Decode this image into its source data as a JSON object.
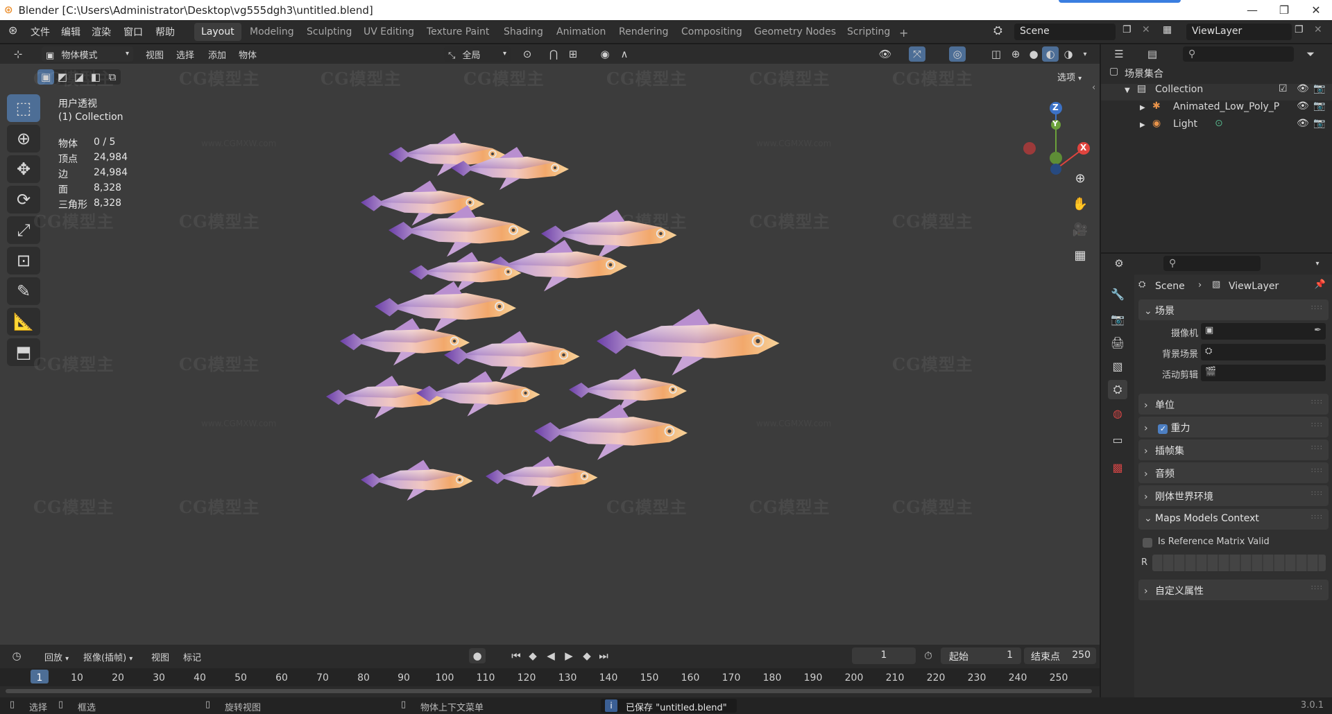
{
  "window": {
    "title": "Blender [C:\\Users\\Administrator\\Desktop\\vg555dgh3\\untitled.blend]"
  },
  "menu": [
    "文件",
    "编辑",
    "渲染",
    "窗口",
    "帮助"
  ],
  "workspaces": [
    {
      "label": "Layout",
      "active": true
    },
    {
      "label": "Modeling"
    },
    {
      "label": "Sculpting"
    },
    {
      "label": "UV Editing"
    },
    {
      "label": "Texture Paint"
    },
    {
      "label": "Shading"
    },
    {
      "label": "Animation"
    },
    {
      "label": "Rendering"
    },
    {
      "label": "Compositing"
    },
    {
      "label": "Geometry Nodes"
    },
    {
      "label": "Scripting"
    }
  ],
  "scene_field": "Scene",
  "viewlayer_field": "ViewLayer",
  "viewport_header": {
    "mode": "物体模式",
    "menus": [
      "视图",
      "选择",
      "添加",
      "物体"
    ],
    "transform_orientation": "全局",
    "options": "选项"
  },
  "viewport": {
    "view_name": "用户透视",
    "collection": "(1) Collection",
    "stats": [
      {
        "label": "物体",
        "value": "0 / 5"
      },
      {
        "label": "顶点",
        "value": "24,984"
      },
      {
        "label": "边",
        "value": "24,984"
      },
      {
        "label": "面",
        "value": "8,328"
      },
      {
        "label": "三角形",
        "value": "8,328"
      }
    ],
    "gizmo": {
      "x": "X",
      "y": "Y",
      "z": "Z"
    },
    "watermark": "CG模型主",
    "watermark_url": "www.CGMXW.com"
  },
  "outliner": {
    "root": "场景集合",
    "items": [
      {
        "label": "Collection",
        "level": 0
      },
      {
        "label": "Animated_Low_Poly_P",
        "level": 1
      },
      {
        "label": "Light",
        "level": 1
      }
    ]
  },
  "properties": {
    "breadcrumb_scene": "Scene",
    "breadcrumb_layer": "ViewLayer",
    "section_title": "场景",
    "camera_label": "摄像机",
    "background_label": "背景场景",
    "clip_label": "活动剪辑",
    "panels": [
      {
        "label": "单位"
      },
      {
        "label": "重力",
        "checkbox": true
      },
      {
        "label": "插帧集"
      },
      {
        "label": "音频"
      },
      {
        "label": "刚体世界环境"
      }
    ],
    "maps_panel": "Maps Models Context",
    "ref_matrix_label": "Is Reference Matrix Valid",
    "r_label": "R",
    "custom_props": "自定义属性"
  },
  "timeline": {
    "playback": "回放",
    "keying": "抠像(插帧)",
    "view": "视图",
    "marker": "标记",
    "current_frame": "1",
    "start_label": "起始",
    "start_value": "1",
    "end_label": "结束点",
    "end_value": "250",
    "ticks": [
      "1",
      "10",
      "20",
      "30",
      "40",
      "50",
      "60",
      "70",
      "80",
      "90",
      "100",
      "110",
      "120",
      "130",
      "140",
      "150",
      "160",
      "170",
      "180",
      "190",
      "200",
      "210",
      "220",
      "230",
      "240",
      "250"
    ]
  },
  "statusbar": {
    "select": "选择",
    "box_select": "框选",
    "rotate_view": "旋转视图",
    "context_menu": "物体上下文菜单",
    "saved_msg": "已保存 \"untitled.blend\"",
    "version": "3.0.1"
  },
  "colors": {
    "accent": "#4d6e96",
    "viewport_bg": "#3c3c3c",
    "panel_bg": "#2b2b2b",
    "axis_x": "#e0443e",
    "axis_y": "#6ca13b",
    "axis_z": "#3c72c6"
  }
}
